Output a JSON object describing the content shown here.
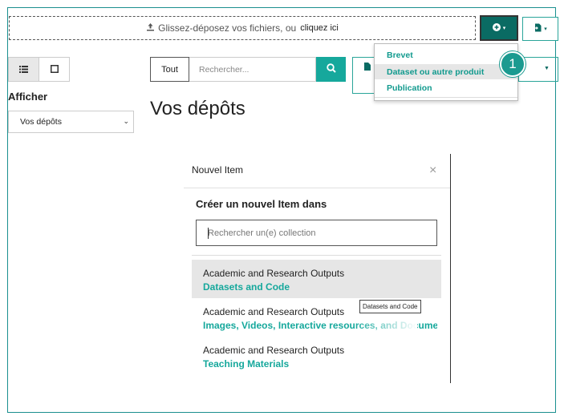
{
  "upload": {
    "drop_text": "Glissez-déposez vos fichiers, ou",
    "link_text": "cliquez ici"
  },
  "toolbar": {
    "add_icon": "plus-circle-icon",
    "import_icon": "file-import-icon"
  },
  "add_menu": {
    "items": [
      {
        "label": "Brevet",
        "highlighted": false
      },
      {
        "label": "Dataset ou autre produit",
        "highlighted": true
      },
      {
        "label": "Publication",
        "highlighted": false
      }
    ]
  },
  "callout": {
    "number": "1"
  },
  "sidebar": {
    "view_modes": [
      "list-view-icon",
      "grid-view-icon"
    ],
    "show_label": "Afficher",
    "show_select_value": "Vos dépôts"
  },
  "search": {
    "scope_label": "Tout",
    "placeholder": "Rechercher..."
  },
  "page": {
    "title": "Vos dépôts"
  },
  "modal": {
    "title": "Nouvel Item",
    "close": "×",
    "subtitle": "Créer un nouvel Item dans",
    "collection_search_placeholder": "Rechercher un(e) collection",
    "collections": [
      {
        "parent": "Academic and Research Outputs",
        "name": "Datasets and Code"
      },
      {
        "parent": "Academic and Research Outputs",
        "name": "Images, Videos, Interactive resources, and Documents"
      },
      {
        "parent": "Academic and Research Outputs",
        "name": "Teaching Materials"
      }
    ],
    "tooltip": "Datasets and Code"
  },
  "colors": {
    "accent": "#16a89c",
    "dark_accent": "#0a6b63"
  }
}
